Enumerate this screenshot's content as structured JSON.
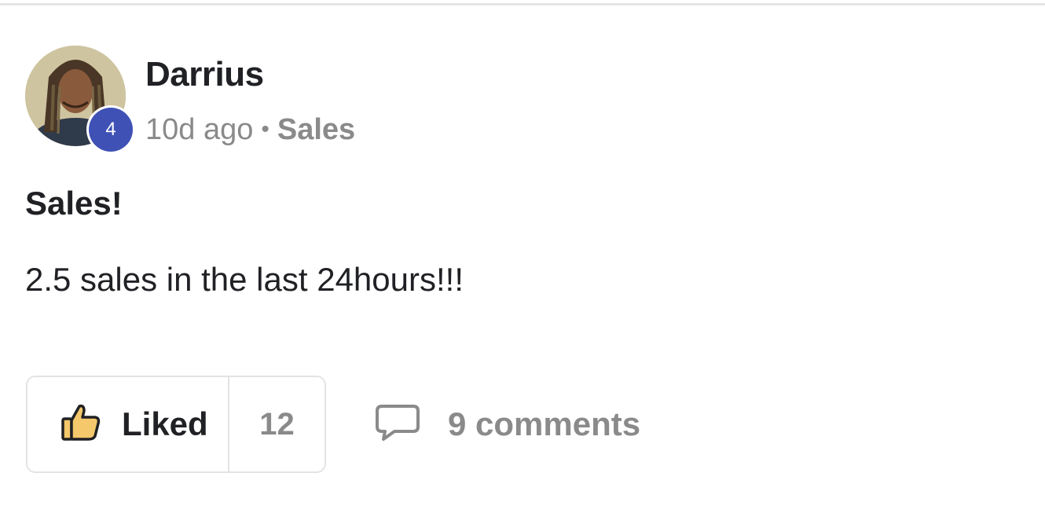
{
  "post": {
    "author": {
      "name": "Darrius",
      "level": "4"
    },
    "meta": {
      "time": "10d ago",
      "separator": "•",
      "category": "Sales"
    },
    "title": "Sales!",
    "body": "2.5 sales in the last 24hours!!!",
    "actions": {
      "like_label": "Liked",
      "like_count": "12",
      "comments_label": "9 comments"
    }
  },
  "colors": {
    "badge": "#3f51b5",
    "thumb_fill": "#f4c86b",
    "muted_text": "#8a8a8a",
    "primary_text": "#202124"
  },
  "icons": {
    "like": "thumbs-up-icon",
    "comment": "speech-bubble-icon"
  }
}
